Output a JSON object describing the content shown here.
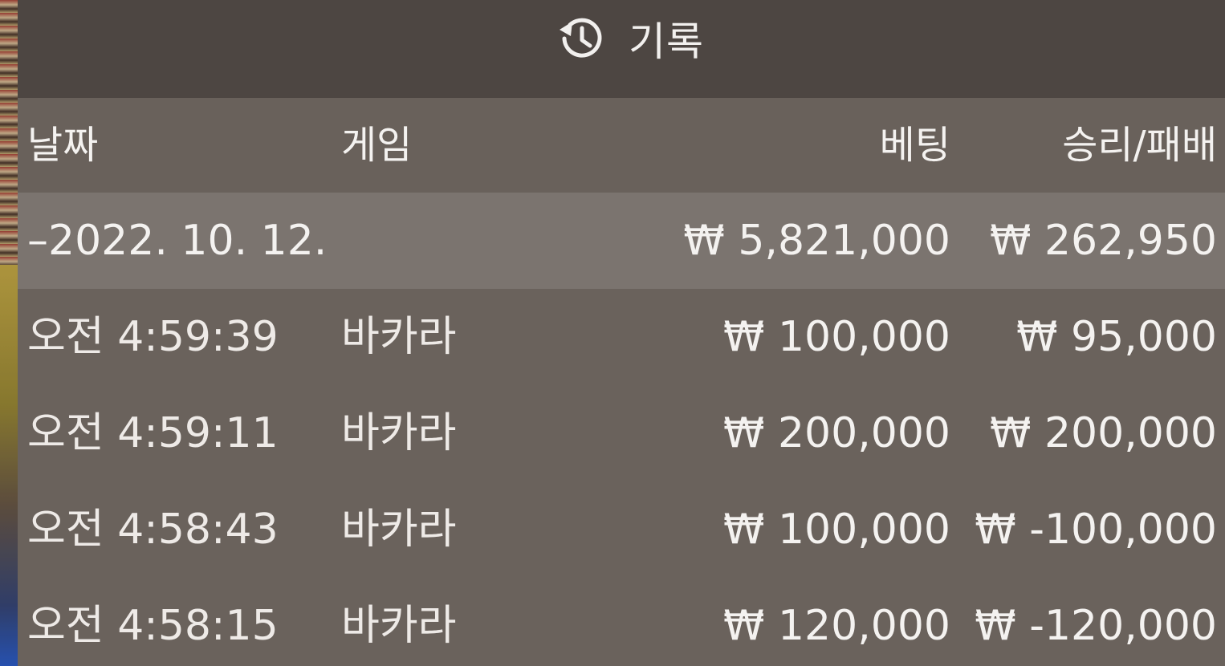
{
  "header": {
    "icon": "history-icon",
    "title": "기록"
  },
  "columns": {
    "date": "날짜",
    "game": "게임",
    "bet": "베팅",
    "result": "승리/패배"
  },
  "date_group": {
    "date": "–2022. 10. 12.",
    "bet_total": "₩ 5,821,000",
    "result_total": "₩ 262,950"
  },
  "rows": [
    {
      "time": "오전 4:59:39",
      "game": "바카라",
      "bet": "₩ 100,000",
      "result": "₩ 95,000"
    },
    {
      "time": "오전 4:59:11",
      "game": "바카라",
      "bet": "₩ 200,000",
      "result": "₩ 200,000"
    },
    {
      "time": "오전 4:58:43",
      "game": "바카라",
      "bet": "₩ 100,000",
      "result": "₩ -100,000"
    },
    {
      "time": "오전 4:58:15",
      "game": "바카라",
      "bet": "₩ 120,000",
      "result": "₩ -120,000"
    }
  ]
}
